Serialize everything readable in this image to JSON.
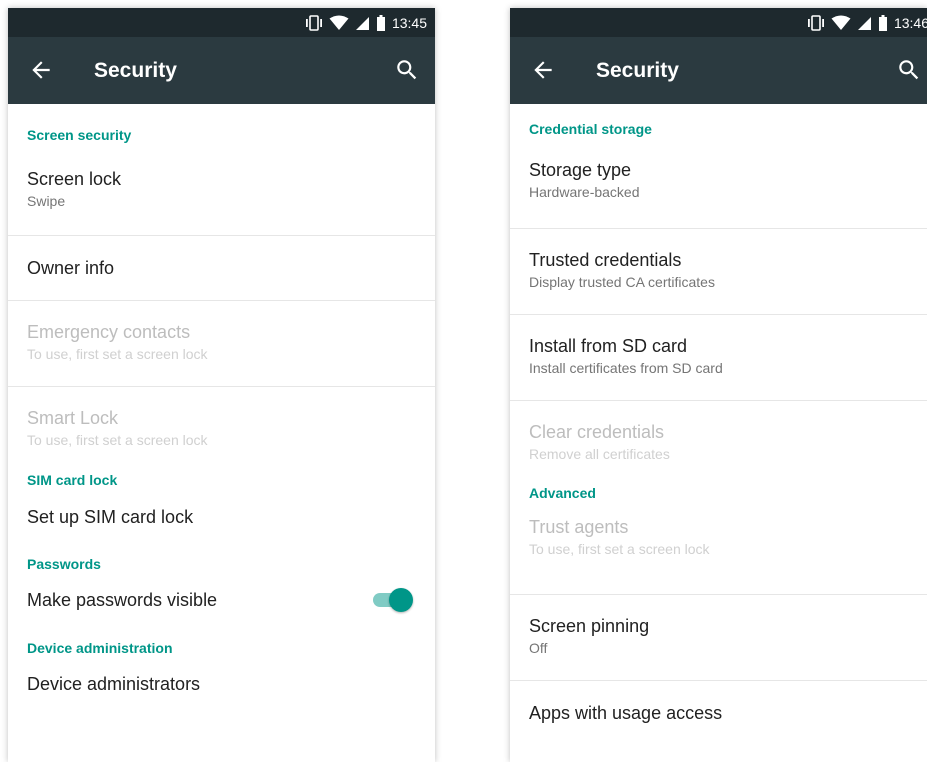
{
  "left": {
    "status": {
      "time": "13:45"
    },
    "toolbar": {
      "title": "Security"
    },
    "sections": {
      "screen_security": "Screen security",
      "sim_card_lock": "SIM card lock",
      "passwords": "Passwords",
      "device_administration": "Device administration"
    },
    "items": {
      "screen_lock": {
        "title": "Screen lock",
        "summary": "Swipe"
      },
      "owner_info": {
        "title": "Owner info"
      },
      "emergency_contacts": {
        "title": "Emergency contacts",
        "summary": "To use, first set a screen lock"
      },
      "smart_lock": {
        "title": "Smart Lock",
        "summary": "To use, first set a screen lock"
      },
      "sim_lock": {
        "title": "Set up SIM card lock"
      },
      "passwords_visible": {
        "title": "Make passwords visible",
        "checked": true
      },
      "device_admins": {
        "title": "Device administrators"
      }
    }
  },
  "right": {
    "status": {
      "time": "13:46"
    },
    "toolbar": {
      "title": "Security"
    },
    "sections": {
      "credential_storage": "Credential storage",
      "advanced": "Advanced"
    },
    "items": {
      "storage_type": {
        "title": "Storage type",
        "summary": "Hardware-backed"
      },
      "trusted_credentials": {
        "title": "Trusted credentials",
        "summary": "Display trusted CA certificates"
      },
      "install_sd": {
        "title": "Install from SD card",
        "summary": "Install certificates from SD card"
      },
      "clear_credentials": {
        "title": "Clear credentials",
        "summary": "Remove all certificates"
      },
      "trust_agents": {
        "title": "Trust agents",
        "summary": "To use, first set a screen lock"
      },
      "screen_pinning": {
        "title": "Screen pinning",
        "summary": "Off"
      },
      "usage_access": {
        "title": "Apps with usage access"
      }
    }
  },
  "colors": {
    "statusbar": "#1e292e",
    "toolbar": "#2b3a40",
    "accent": "#009688",
    "toggle_track": "#80cbc4"
  },
  "icons": [
    "vibrate-icon",
    "wifi-icon",
    "signal-icon",
    "battery-icon",
    "back-arrow-icon",
    "search-icon"
  ]
}
